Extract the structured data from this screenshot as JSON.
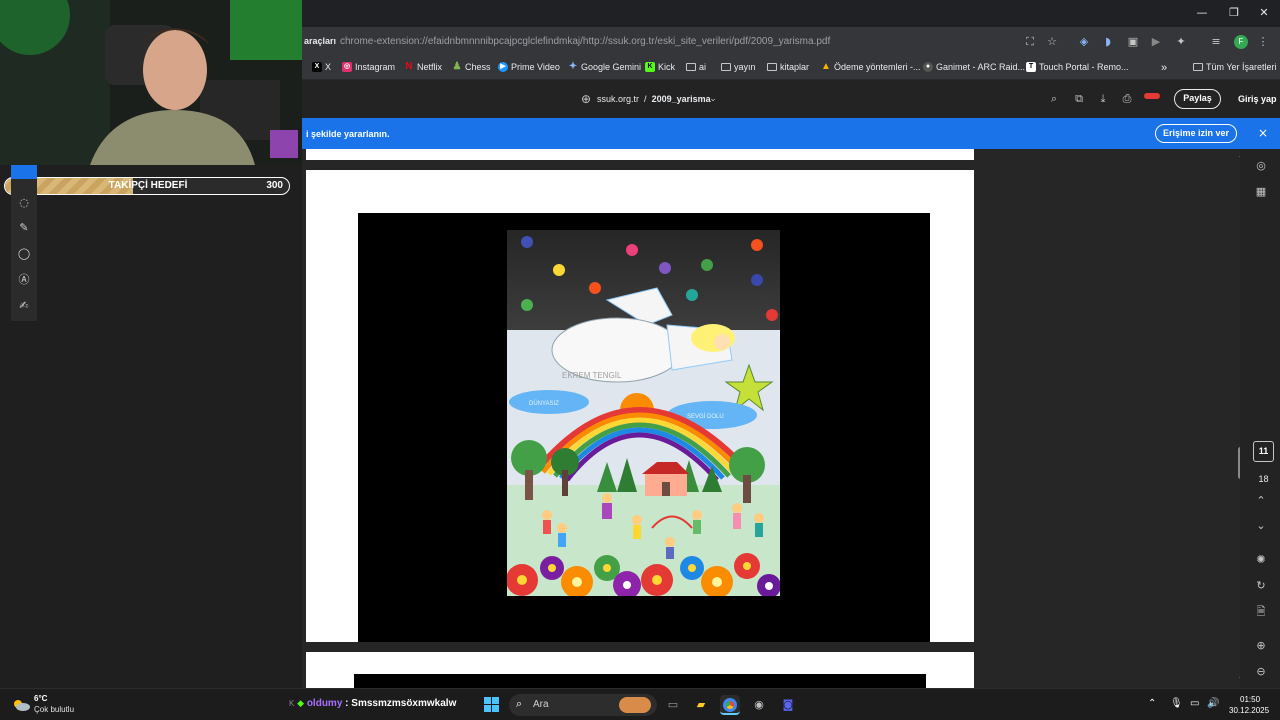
{
  "browser": {
    "tab_stub": "araçları",
    "address": "chrome-extension://efaidnbmnnnibpcajpcglclefindmkaj/http://ssuk.org.tr/eski_site_verileri/pdf/2009_yarisma.pdf",
    "profile_initial": "F",
    "bookmarks": [
      {
        "label": "X",
        "icon": "x-logo-icon",
        "color": "#000000"
      },
      {
        "label": "Instagram",
        "icon": "instagram-icon",
        "color": "#e1306c"
      },
      {
        "label": "Netflix",
        "icon": "netflix-icon",
        "color": "#e50914"
      },
      {
        "label": "Chess",
        "icon": "chess-pawn-icon",
        "color": "#81b64c"
      },
      {
        "label": "Prime Video",
        "icon": "prime-video-icon",
        "color": "#1a98ff"
      },
      {
        "label": "Google Gemini",
        "icon": "gemini-icon",
        "color": "#8ab4f8"
      },
      {
        "label": "Kick",
        "icon": "kick-icon",
        "color": "#53fc18"
      },
      {
        "label": "ai",
        "icon": "folder-icon"
      },
      {
        "label": "yayın",
        "icon": "folder-icon"
      },
      {
        "label": "kitaplar",
        "icon": "folder-icon"
      },
      {
        "label": "Ödeme yöntemleri -...",
        "icon": "payment-icon",
        "color": "#f4b400"
      },
      {
        "label": "Ganimet - ARC Raid...",
        "icon": "arc-raiders-icon",
        "color": "#555555"
      },
      {
        "label": "Touch Portal - Remo...",
        "icon": "touch-portal-icon",
        "color": "#ffffff"
      }
    ],
    "all_bookmarks": "Tüm Yer İşaretleri"
  },
  "pdf": {
    "domain": "ssuk.org.tr",
    "separator": "/",
    "filename": "2009_yarisma",
    "share_label": "Paylaş",
    "signin_label": "Giriş yap",
    "current_page": "11",
    "total_pages": "18"
  },
  "banner": {
    "text": "i şekilde yararlanın.",
    "allow_label": "Erişime izin ver",
    "close_glyph": "×"
  },
  "drawing": {
    "handwritten_1": "EKREM TENGİL",
    "handwritten_2": "DÜNYASIZ",
    "handwritten_3": "SEVGİ DOLU"
  },
  "stream": {
    "goal_current": "136",
    "goal_label": "TAKİPÇİ HEDEFİ",
    "goal_max": "300",
    "goal_progress": 0.45
  },
  "taskbar": {
    "weather_temp": "6°C",
    "weather_desc": "Çok bulutlu",
    "chat_prefix": "K",
    "chat_user": "oldumy",
    "chat_sep": ":",
    "chat_message": "Smssmzmsöxmwkalw",
    "search_placeholder": "Ara",
    "time": "01:50",
    "date": "30.12.2025"
  },
  "colors": {
    "banner_blue": "#1a73e8",
    "twitch_purple": "#a970ff",
    "goal_gold": "#d9b877"
  }
}
